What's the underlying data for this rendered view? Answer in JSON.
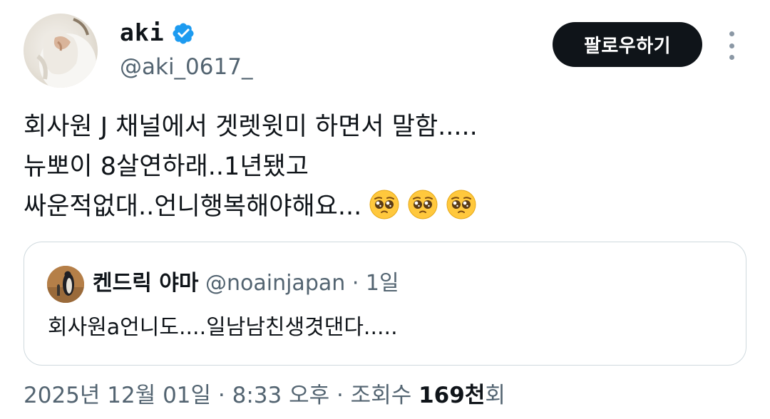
{
  "author": {
    "name": "aki",
    "handle": "@aki_0617_",
    "verified_color": "#1d9bf0"
  },
  "follow_button": {
    "label": "팔로우하기"
  },
  "more_menu": {
    "icon": "more-vertical-icon"
  },
  "tweet": {
    "lines": [
      "회사원 J 채널에서 겟렛윗미 하면서 말함.....",
      "뉴뽀이 8살연하래..1년됐고",
      "싸운적없대..언니행복해야해요..."
    ],
    "emojis": [
      "pleading-face-icon",
      "pleading-face-icon",
      "pleading-face-icon"
    ]
  },
  "quote": {
    "name": "켄드릭 야마",
    "handle": "@noainjapan",
    "separator": "·",
    "time": "1일",
    "text": "회사원a언니도....일남남친생겻댄다....."
  },
  "meta": {
    "datetime": "2025년 12월 01일 · 8:33 오후 · 조회수 ",
    "views": "169천",
    "views_suffix": "회"
  }
}
